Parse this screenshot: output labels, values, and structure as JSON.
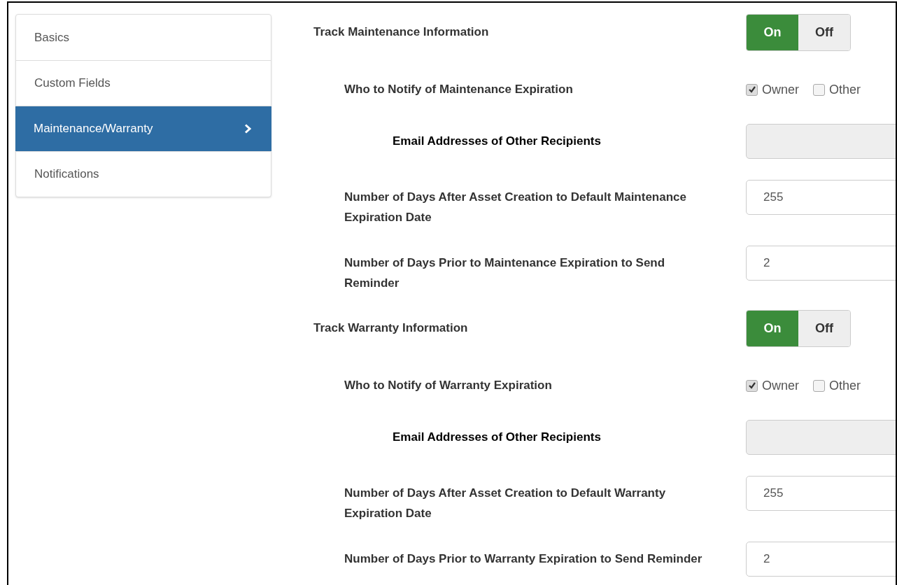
{
  "sidebar": {
    "items": [
      {
        "label": "Basics",
        "selected": false
      },
      {
        "label": "Custom Fields",
        "selected": false
      },
      {
        "label": "Maintenance/Warranty",
        "selected": true
      },
      {
        "label": "Notifications",
        "selected": false
      }
    ]
  },
  "sections": [
    {
      "title": "Track Maintenance Information",
      "toggle": {
        "on_label": "On",
        "off_label": "Off",
        "on": true
      },
      "fields": [
        {
          "kind": "checkboxes",
          "label": "Who to Notify of Maintenance Expiration",
          "options": [
            {
              "label": "Owner",
              "checked": true
            },
            {
              "label": "Other",
              "checked": false
            }
          ]
        },
        {
          "kind": "email",
          "label": "Email Addresses of Other Recipients",
          "disabled": true
        },
        {
          "kind": "number",
          "label": "Number of Days After Asset Creation to Default Maintenance Expiration Date",
          "value": "255"
        },
        {
          "kind": "number",
          "label": "Number of Days Prior to Maintenance Expiration to Send Reminder",
          "value": "2"
        }
      ]
    },
    {
      "title": "Track Warranty Information",
      "toggle": {
        "on_label": "On",
        "off_label": "Off",
        "on": true
      },
      "fields": [
        {
          "kind": "checkboxes",
          "label": "Who to Notify of Warranty Expiration",
          "options": [
            {
              "label": "Owner",
              "checked": true
            },
            {
              "label": "Other",
              "checked": false
            }
          ]
        },
        {
          "kind": "email",
          "label": "Email Addresses of Other Recipients",
          "disabled": true
        },
        {
          "kind": "number",
          "label": "Number of Days After Asset Creation to Default Warranty Expiration Date",
          "value": "255"
        },
        {
          "kind": "number",
          "label": "Number of Days Prior to Warranty Expiration to Send Reminder",
          "value": "2"
        }
      ]
    }
  ]
}
